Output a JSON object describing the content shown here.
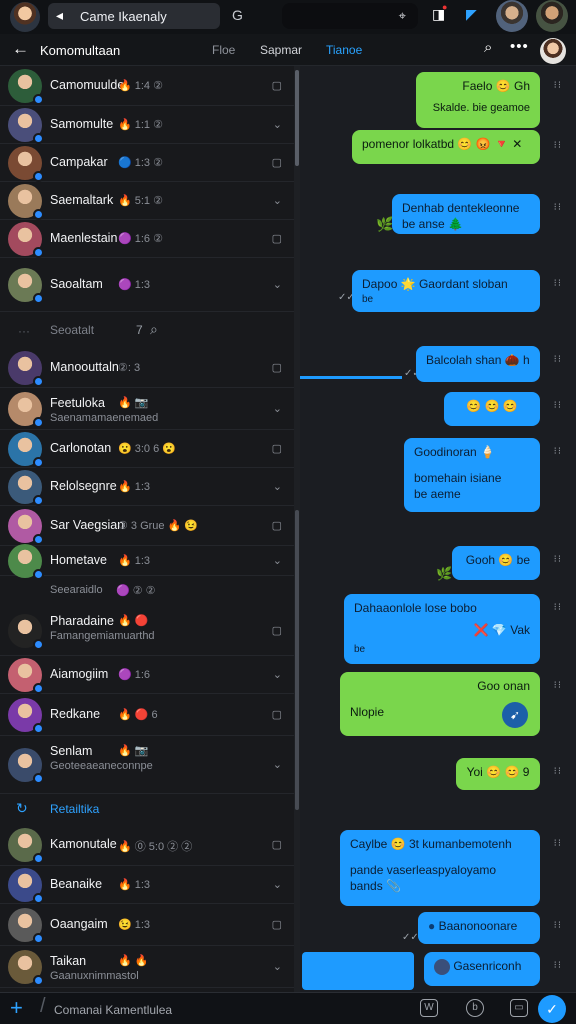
{
  "topbar": {
    "search_label": "Came Ikaenaly",
    "g_icon_label": "G"
  },
  "header": {
    "title": "Komomultaan",
    "tabs": [
      "Floe",
      "Sapmar",
      "Tianoe"
    ]
  },
  "contacts": [
    {
      "name": "Camomuulde",
      "meta": "🔥 1:4 ②",
      "color": "#2d5d3a"
    },
    {
      "name": "Samomulte",
      "meta": "🔥 1:1 ②",
      "color": "#4a4e7a"
    },
    {
      "name": "Campakar",
      "meta": "🔵 1:3 ②",
      "color": "#7a4a33"
    },
    {
      "name": "Saemaltark",
      "meta": "🔥 5:1 ②",
      "color": "#9a7a5a"
    },
    {
      "name": "Maenlestain",
      "meta": "🟣 1:6 ②",
      "color": "#a34a5e"
    },
    {
      "name": "Saoaltam",
      "meta": "🟣 1:3",
      "color": "#6b7a55"
    }
  ],
  "section_1": {
    "label": "Seoatalt",
    "meta": "7"
  },
  "contacts_2": [
    {
      "name": "Manoouttaln",
      "meta": "②: 3",
      "color": "#4a3a6a"
    },
    {
      "name": "Feetuloka",
      "sub": "Saenamamaenemaed",
      "meta": "🔥 📷",
      "color": "#b58a6a"
    },
    {
      "name": "Carlonotan",
      "meta": "😮 3:0 6 😮",
      "color": "#2b74a8"
    },
    {
      "name": "Relolsegnre",
      "meta": "🔥 1:3",
      "color": "#3b5a7a"
    },
    {
      "name": "Sar Vaegsian",
      "meta": "③ 3 Grue 🔥 😉",
      "color": "#b05aa3"
    },
    {
      "name": "Hometave",
      "meta": "🔥 1:3",
      "color": "#4d8a4a"
    }
  ],
  "section_2": {
    "label": "Seearaidlo",
    "meta": "🟣 ② ②"
  },
  "contacts_3": [
    {
      "name": "Pharadaine",
      "sub": "Famangemiamuarthd",
      "meta": "🔥 🔴",
      "color": "#232323"
    },
    {
      "name": "Aiamogiim",
      "meta": "🟣 1:6",
      "color": "#c46070"
    },
    {
      "name": "Redkane",
      "meta": "🔥 🔴 6",
      "color": "#7a3aa8"
    },
    {
      "name": "Senlam",
      "sub": "Geoteeaeaneconnpe",
      "meta": "🔥 📷",
      "color": "#3a4b6a"
    }
  ],
  "section_3": {
    "label": "Retailtika"
  },
  "contacts_4": [
    {
      "name": "Kamonutale",
      "meta": "🔥 ⓪ 5:0 ② ②",
      "color": "#5a6a4a"
    },
    {
      "name": "Beanaike",
      "meta": "🔥 1:3",
      "color": "#3b4a8a"
    },
    {
      "name": "Oaangaim",
      "meta": "😉 1:3",
      "color": "#5a5a5a"
    },
    {
      "name": "Taikan",
      "sub": "Gaanuxnimmastol",
      "meta": "🔥 🔥",
      "color": "#6a5a3a"
    }
  ],
  "messages": [
    {
      "text": "Faelo 😊 Gh",
      "sub": "Skalde. bie geamoe",
      "side": "out"
    },
    {
      "text": "pomenor lolkatbd 😊 😡 🔻 ✕",
      "side": "out"
    },
    {
      "text": "Denhab dentekleonne",
      "sub": "be anse 🌲",
      "side": "in"
    },
    {
      "text": "Dapoo 🌟 Gaordant sloban",
      "sub": "be",
      "side": "in"
    },
    {
      "text": "Balcolah shan 🌰 h",
      "side": "in"
    },
    {
      "text": "😊 😊 😊",
      "side": "in"
    },
    {
      "text": "Goodinoran 🍦",
      "sub": "bomehain isiane",
      "sub2": "be aeme",
      "side": "in"
    },
    {
      "text": "Gooh 😊 be",
      "side": "in"
    },
    {
      "text": "Dahaaonlole lose bobo",
      "sub": "❌ 💎 Vak",
      "sub2": "be",
      "side": "in"
    },
    {
      "text": "Goo onan",
      "sub": "Nlopie",
      "side": "out"
    },
    {
      "text": "Yoi 😊 😊 9",
      "side": "out"
    },
    {
      "text": "Caylbe 😊 3t kumanbemotenh",
      "sub": "pande vaserleaspyaloyamo",
      "sub2": "bands 📎",
      "side": "in"
    },
    {
      "text": "Baanonoonare",
      "side": "in"
    },
    {
      "text": "Gasenriconh",
      "side": "in"
    }
  ],
  "composer": {
    "placeholder": "Comanai Kamentlulea"
  },
  "colors": {
    "accent_blue": "#1e9bff",
    "accent_green": "#7ad64c",
    "bg": "#17191d"
  }
}
